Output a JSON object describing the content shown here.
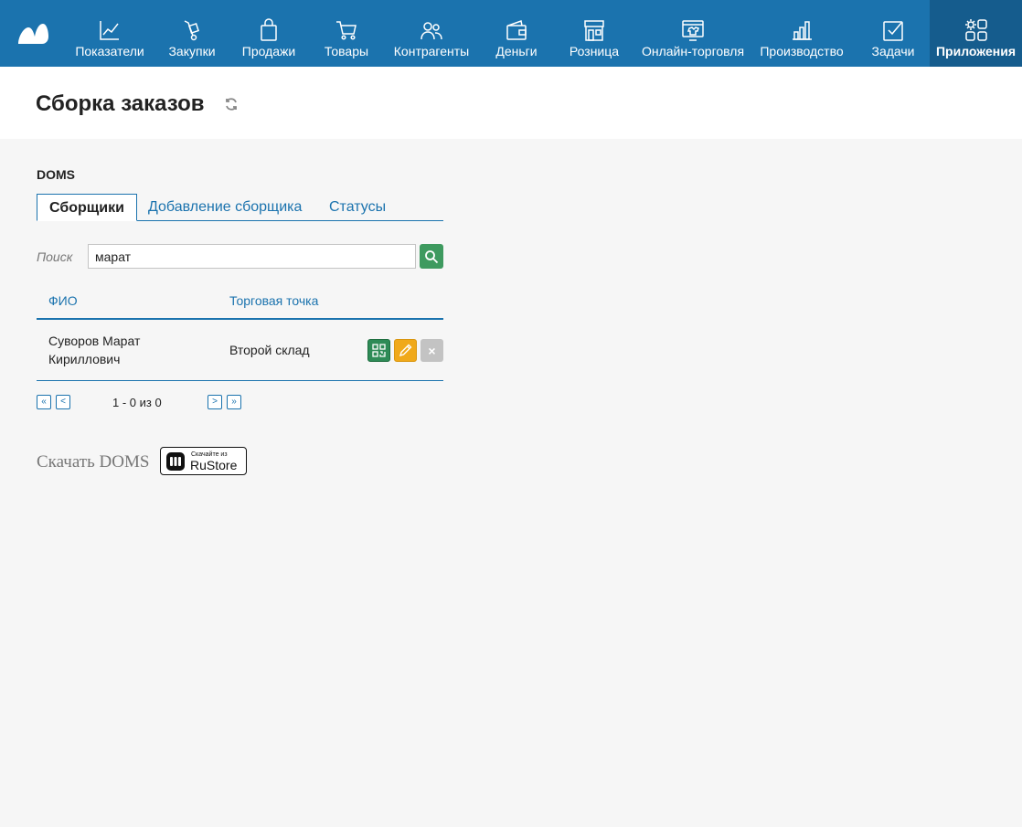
{
  "nav": {
    "items": [
      {
        "label": "Показатели",
        "icon": "chart-line-icon"
      },
      {
        "label": "Закупки",
        "icon": "hand-truck-icon"
      },
      {
        "label": "Продажи",
        "icon": "shopping-bag-icon"
      },
      {
        "label": "Товары",
        "icon": "cart-icon"
      },
      {
        "label": "Контрагенты",
        "icon": "users-icon"
      },
      {
        "label": "Деньги",
        "icon": "wallet-icon"
      },
      {
        "label": "Розница",
        "icon": "storefront-icon"
      },
      {
        "label": "Онлайн-торговля",
        "icon": "online-shop-icon"
      },
      {
        "label": "Производство",
        "icon": "factory-icon"
      },
      {
        "label": "Задачи",
        "icon": "checkbox-icon"
      },
      {
        "label": "Приложения",
        "icon": "apps-gear-icon",
        "active": true
      }
    ]
  },
  "page": {
    "title": "Сборка заказов",
    "section": "DOMS"
  },
  "tabs": [
    {
      "label": "Сборщики",
      "active": true
    },
    {
      "label": "Добавление сборщика"
    },
    {
      "label": "Статусы"
    }
  ],
  "search": {
    "label": "Поиск",
    "value": "марат"
  },
  "table": {
    "headers": [
      "ФИО",
      "Торговая точка"
    ],
    "rows": [
      {
        "name": "Суворов Марат Кириллович",
        "point": "Второй склад"
      }
    ],
    "delete_symbol": "×"
  },
  "pagination": {
    "first": "«",
    "prev": "<",
    "info": "1 - 0 из 0",
    "next": ">",
    "last": "»"
  },
  "download": {
    "label": "Скачать DOMS",
    "badge_small": "Скачайте из",
    "badge_big": "RuStore"
  },
  "colors": {
    "brand": "#1b73ae",
    "nav_active": "#155c8d",
    "search_button": "#3e9a5f",
    "qr_button": "#2e8b57",
    "edit_button": "#f0a91a",
    "delete_button": "#c3c3c3"
  }
}
